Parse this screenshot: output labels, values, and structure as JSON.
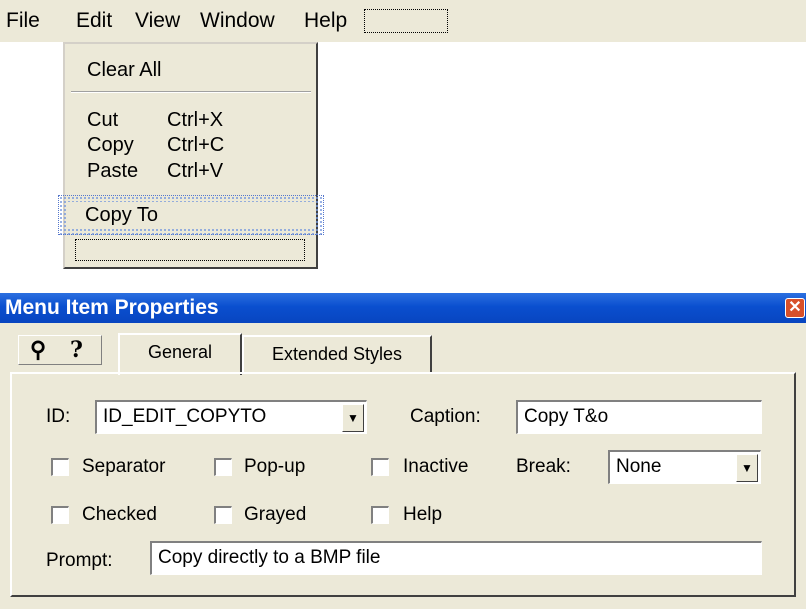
{
  "menubar": {
    "items": [
      {
        "label": "File"
      },
      {
        "label": "Edit"
      },
      {
        "label": "View"
      },
      {
        "label": "Window"
      },
      {
        "label": "Help"
      }
    ]
  },
  "dropdown": {
    "clear_all": "Clear All",
    "cut": {
      "label": "Cut",
      "shortcut": "Ctrl+X"
    },
    "copy": {
      "label": "Copy",
      "shortcut": "Ctrl+C"
    },
    "paste": {
      "label": "Paste",
      "shortcut": "Ctrl+V"
    },
    "copy_to": "Copy To"
  },
  "dialog": {
    "title": "Menu Item Properties",
    "close_glyph": "✕",
    "pin_glyph": "⚲",
    "help_glyph": "?",
    "tabs": [
      {
        "label": "General",
        "active": true
      },
      {
        "label": "Extended Styles",
        "active": false
      }
    ],
    "id_label": "ID:",
    "id_value": "ID_EDIT_COPYTO",
    "caption_label": "Caption:",
    "caption_value": "Copy T&o",
    "checkboxes": {
      "separator": {
        "label": "Separator",
        "checked": false
      },
      "popup": {
        "label": "Pop-up",
        "checked": false
      },
      "inactive": {
        "label": "Inactive",
        "checked": false
      },
      "checked": {
        "label": "Checked",
        "checked": false
      },
      "grayed": {
        "label": "Grayed",
        "checked": false
      },
      "help": {
        "label": "Help",
        "checked": false
      }
    },
    "break_label": "Break:",
    "break_value": "None",
    "prompt_label": "Prompt:",
    "prompt_value": "Copy directly to a BMP file",
    "dropdown_arrow": "▼"
  },
  "colors": {
    "face": "#ece9d8",
    "titlebar": "#0a4fcf",
    "close": "#d8502a"
  }
}
